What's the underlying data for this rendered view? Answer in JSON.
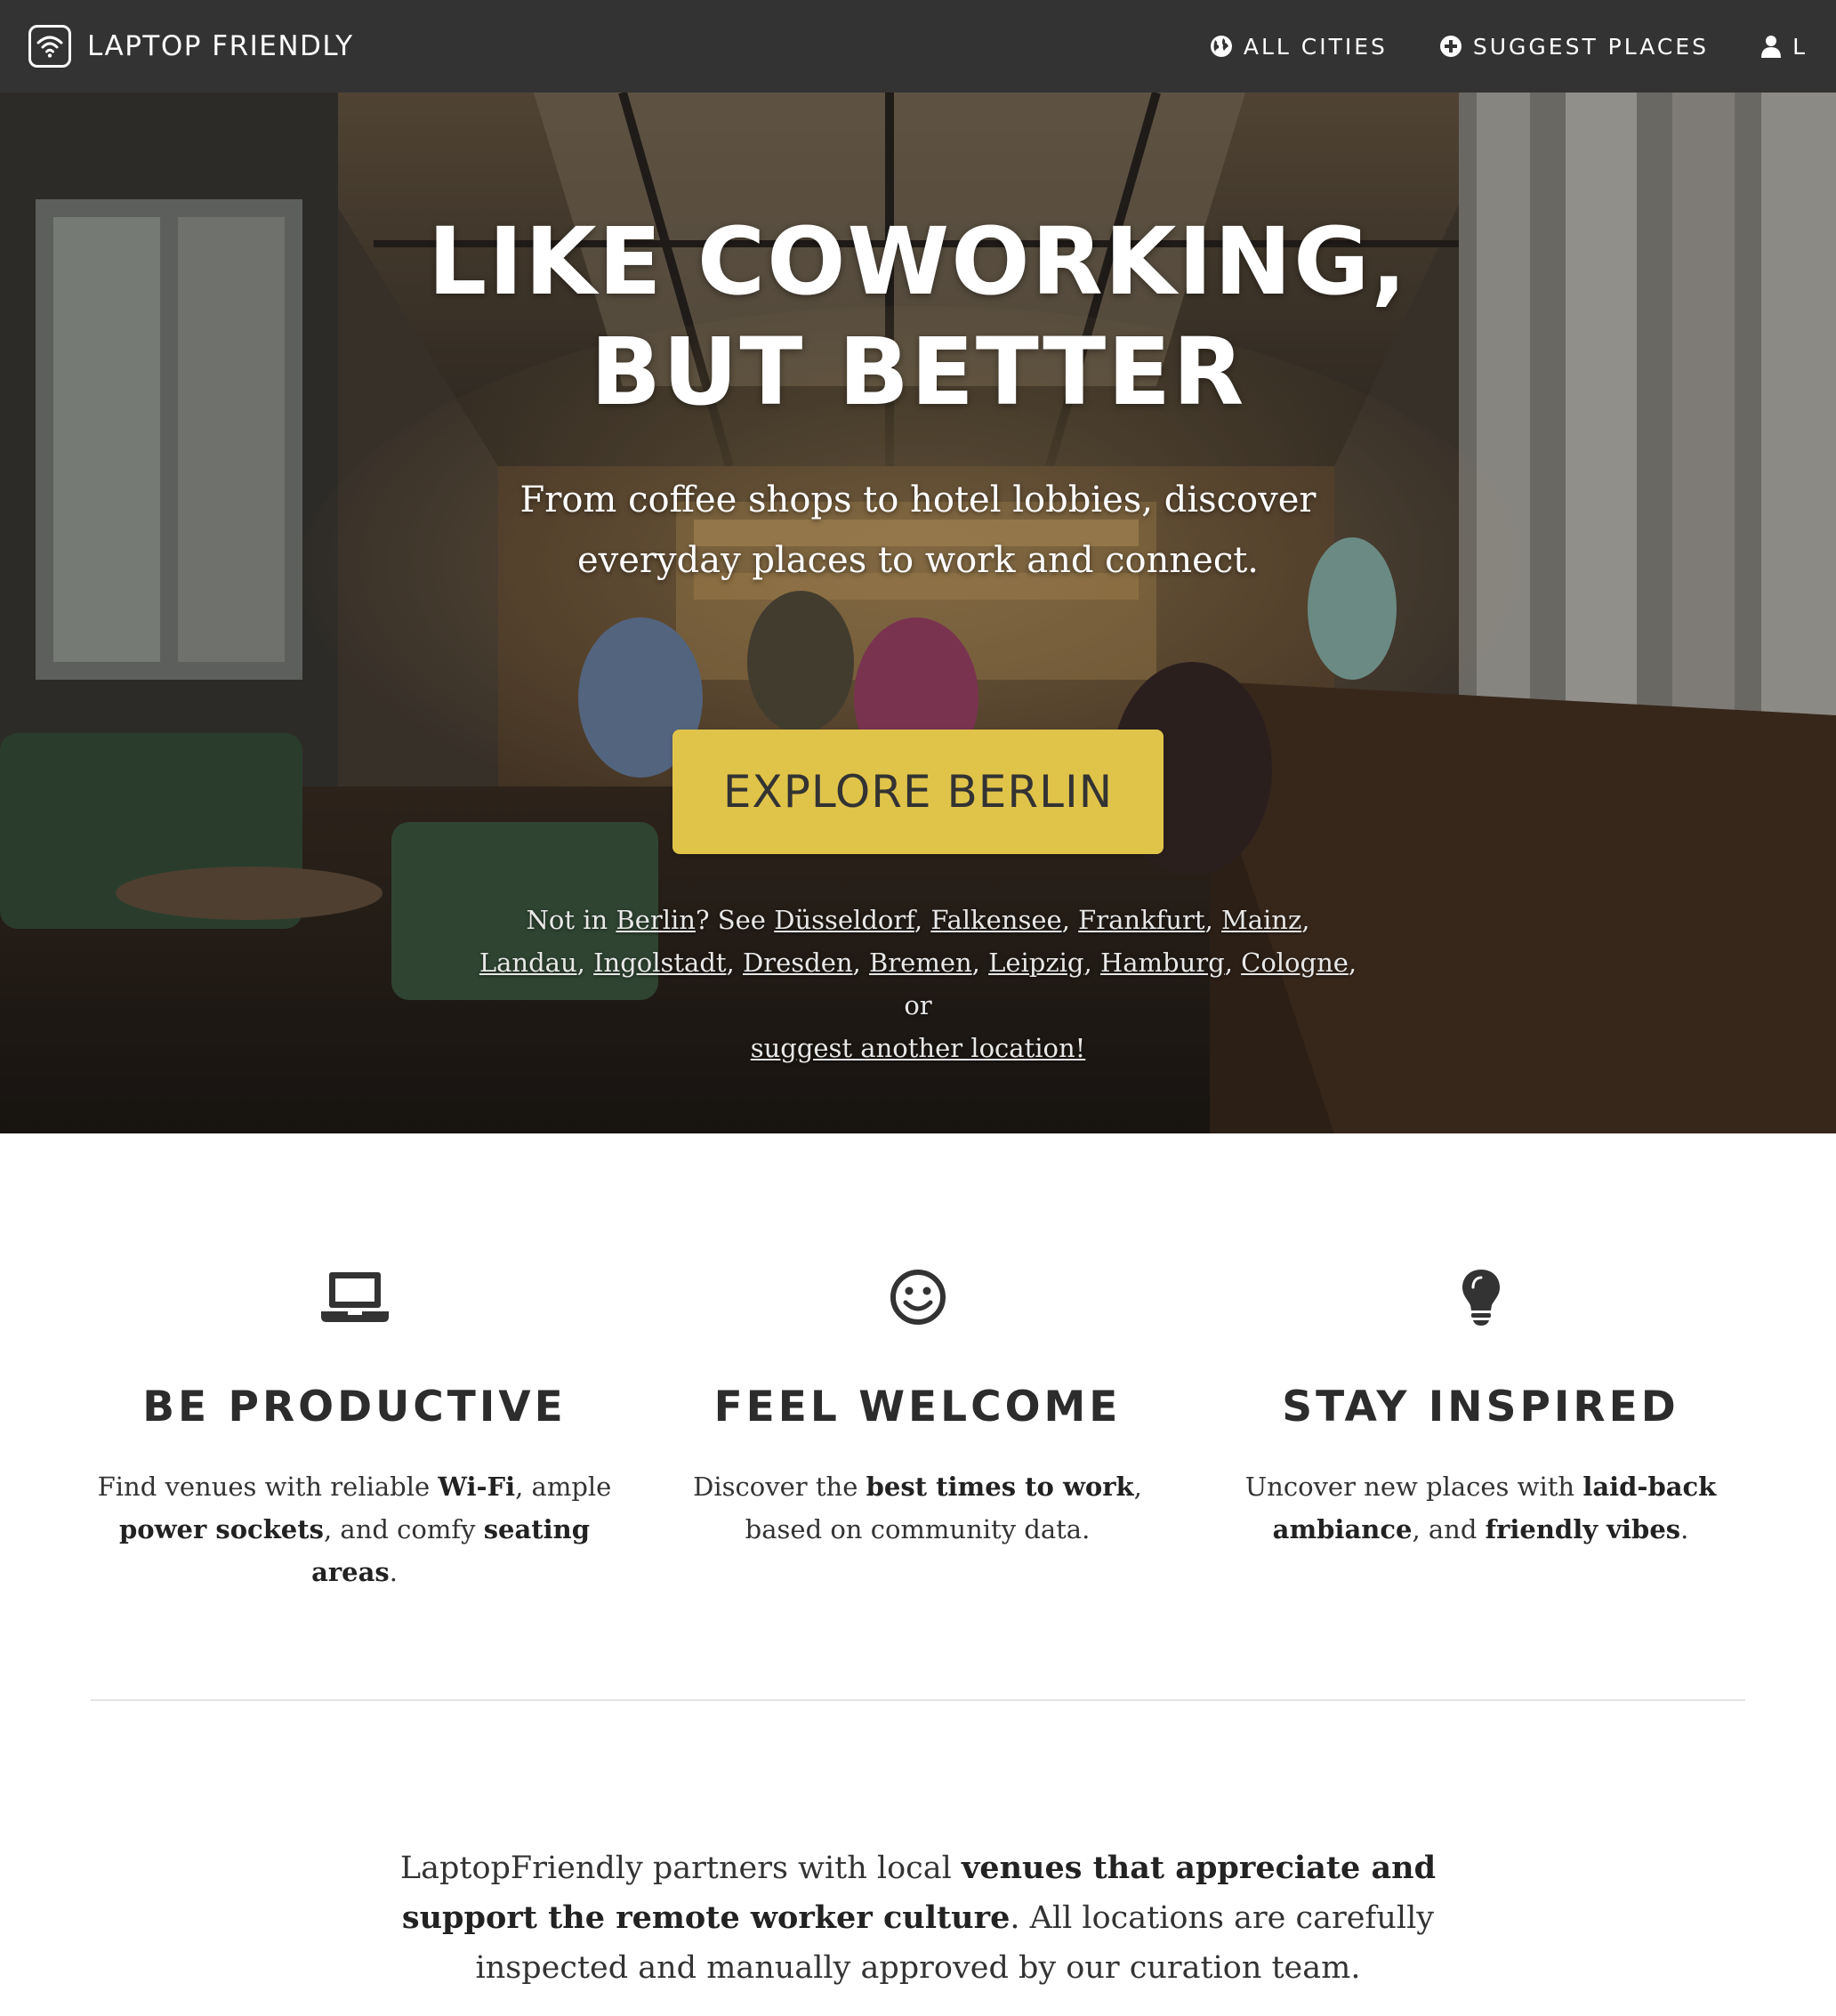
{
  "nav": {
    "brand": "LAPTOP FRIENDLY",
    "all_cities": "ALL CITIES",
    "suggest_places": "SUGGEST PLACES",
    "user": "L"
  },
  "hero": {
    "title_line1": "LIKE COWORKING,",
    "title_line2": "BUT BETTER",
    "subtitle": "From coffee shops to hotel lobbies, discover everyday places to work and connect.",
    "cta_label": "EXPLORE BERLIN",
    "cities_prefix": "Not in",
    "current_city": "Berlin",
    "see_text": "? See",
    "other_cities": [
      "Düsseldorf",
      "Falkensee",
      "Frankfurt",
      "Mainz",
      "Landau",
      "Ingolstadt",
      "Dresden",
      "Bremen",
      "Leipzig",
      "Hamburg",
      "Cologne"
    ],
    "or_text": ", or",
    "suggest_link": "suggest another location!"
  },
  "features": [
    {
      "icon": "laptop-icon",
      "title": "BE PRODUCTIVE",
      "parts": [
        {
          "t": "Find venues with reliable ",
          "b": false
        },
        {
          "t": "Wi-Fi",
          "b": true
        },
        {
          "t": ", ample ",
          "b": false
        },
        {
          "t": "power sockets",
          "b": true
        },
        {
          "t": ", and comfy ",
          "b": false
        },
        {
          "t": "seating areas",
          "b": true
        },
        {
          "t": ".",
          "b": false
        }
      ]
    },
    {
      "icon": "smiley-icon",
      "title": "FEEL WELCOME",
      "parts": [
        {
          "t": "Discover the ",
          "b": false
        },
        {
          "t": "best times to work",
          "b": true
        },
        {
          "t": ", based on community data.",
          "b": false
        }
      ]
    },
    {
      "icon": "lightbulb-icon",
      "title": "STAY INSPIRED",
      "parts": [
        {
          "t": "Uncover new places with ",
          "b": false
        },
        {
          "t": "laid-back ambiance",
          "b": true
        },
        {
          "t": ", and ",
          "b": false
        },
        {
          "t": "friendly vibes",
          "b": true
        },
        {
          "t": ".",
          "b": false
        }
      ]
    }
  ],
  "about": {
    "parts": [
      {
        "t": "LaptopFriendly partners with local ",
        "b": false
      },
      {
        "t": "venues that appreciate and support the remote worker culture",
        "b": true
      },
      {
        "t": ". All locations are carefully inspected and manually approved by our curation team.",
        "b": false
      }
    ]
  },
  "colors": {
    "nav_bg": "#333333",
    "cta_bg": "#e0c44a",
    "text": "#333333"
  }
}
